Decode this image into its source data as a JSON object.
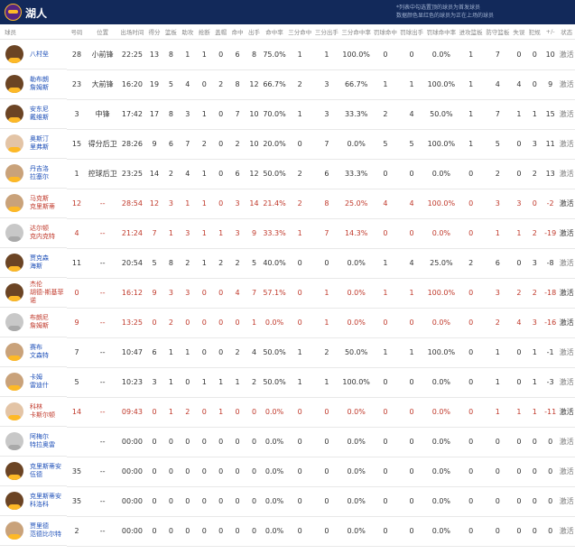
{
  "header": {
    "title": "湖人",
    "note_line1": "*列表中勾选置顶的球员为首发球员",
    "note_line2": "数据颜色显红色的球员为正在上场的球员"
  },
  "columns": [
    "球员",
    "号码",
    "位置",
    "出场时间",
    "得分",
    "篮板",
    "助攻",
    "抢断",
    "盖帽",
    "命中",
    "出手",
    "命中率",
    "三分命中",
    "三分出手",
    "三分命中率",
    "罚球命中",
    "罚球出手",
    "罚球命中率",
    "进攻篮板",
    "防守篮板",
    "失误",
    "犯规",
    "+/-",
    "状态"
  ],
  "players": [
    {
      "name": "八村垒",
      "avatar": "dark",
      "red": false,
      "cells": [
        "28",
        "小前锋",
        "22:25",
        "13",
        "8",
        "1",
        "1",
        "0",
        "6",
        "8",
        "75.0%",
        "1",
        "1",
        "100.0%",
        "0",
        "0",
        "0.0%",
        "1",
        "7",
        "0",
        "0",
        "10",
        "激活"
      ]
    },
    {
      "name": "勒布朗\n詹姆斯",
      "avatar": "dark",
      "red": false,
      "cells": [
        "23",
        "大前锋",
        "16:20",
        "19",
        "5",
        "4",
        "0",
        "2",
        "8",
        "12",
        "66.7%",
        "2",
        "3",
        "66.7%",
        "1",
        "1",
        "100.0%",
        "1",
        "4",
        "4",
        "0",
        "9",
        "激活"
      ]
    },
    {
      "name": "安东尼\n戴维斯",
      "avatar": "dark",
      "red": false,
      "cells": [
        "3",
        "中锋",
        "17:42",
        "17",
        "8",
        "3",
        "1",
        "0",
        "7",
        "10",
        "70.0%",
        "1",
        "3",
        "33.3%",
        "2",
        "4",
        "50.0%",
        "1",
        "7",
        "1",
        "1",
        "15",
        "激活"
      ]
    },
    {
      "name": "奥斯汀\n里弗斯",
      "avatar": "light",
      "red": false,
      "cells": [
        "15",
        "得分后卫",
        "28:26",
        "9",
        "6",
        "7",
        "2",
        "0",
        "2",
        "10",
        "20.0%",
        "0",
        "7",
        "0.0%",
        "5",
        "5",
        "100.0%",
        "1",
        "5",
        "0",
        "3",
        "11",
        "激活"
      ]
    },
    {
      "name": "丹吉洛\n拉塞尔",
      "avatar": "",
      "red": false,
      "cells": [
        "1",
        "控球后卫",
        "23:25",
        "14",
        "2",
        "4",
        "1",
        "0",
        "6",
        "12",
        "50.0%",
        "2",
        "6",
        "33.3%",
        "0",
        "0",
        "0.0%",
        "0",
        "2",
        "0",
        "2",
        "13",
        "激活"
      ]
    },
    {
      "name": "马克斯\n克里斯蒂",
      "avatar": "",
      "red": true,
      "cells": [
        "12",
        "--",
        "28:54",
        "12",
        "3",
        "1",
        "1",
        "0",
        "3",
        "14",
        "21.4%",
        "2",
        "8",
        "25.0%",
        "4",
        "4",
        "100.0%",
        "0",
        "3",
        "3",
        "0",
        "-2",
        "激活"
      ]
    },
    {
      "name": "达尔顿\n克内克特",
      "avatar": "gray",
      "red": true,
      "cells": [
        "4",
        "--",
        "21:24",
        "7",
        "1",
        "3",
        "1",
        "1",
        "3",
        "9",
        "33.3%",
        "1",
        "7",
        "14.3%",
        "0",
        "0",
        "0.0%",
        "0",
        "1",
        "1",
        "2",
        "-19",
        "激活"
      ]
    },
    {
      "name": "贾克森\n海斯",
      "avatar": "dark",
      "red": false,
      "cells": [
        "11",
        "--",
        "20:54",
        "5",
        "8",
        "2",
        "1",
        "2",
        "2",
        "5",
        "40.0%",
        "0",
        "0",
        "0.0%",
        "1",
        "4",
        "25.0%",
        "2",
        "6",
        "0",
        "3",
        "-8",
        "激活"
      ]
    },
    {
      "name": "杰伦\n胡德-斯基菲\n诺",
      "avatar": "dark",
      "red": true,
      "cells": [
        "0",
        "--",
        "16:12",
        "9",
        "3",
        "3",
        "0",
        "0",
        "4",
        "7",
        "57.1%",
        "0",
        "1",
        "0.0%",
        "1",
        "1",
        "100.0%",
        "0",
        "3",
        "2",
        "2",
        "-18",
        "激活"
      ]
    },
    {
      "name": "布朗尼\n詹姆斯",
      "avatar": "gray",
      "red": true,
      "cells": [
        "9",
        "--",
        "13:25",
        "0",
        "2",
        "0",
        "0",
        "0",
        "0",
        "1",
        "0.0%",
        "0",
        "1",
        "0.0%",
        "0",
        "0",
        "0.0%",
        "0",
        "2",
        "4",
        "3",
        "-16",
        "激活"
      ]
    },
    {
      "name": "赛布\n文森特",
      "avatar": "",
      "red": false,
      "cells": [
        "7",
        "--",
        "10:47",
        "6",
        "1",
        "1",
        "0",
        "0",
        "2",
        "4",
        "50.0%",
        "1",
        "2",
        "50.0%",
        "1",
        "1",
        "100.0%",
        "0",
        "1",
        "0",
        "1",
        "-1",
        "激活"
      ]
    },
    {
      "name": "卡姆\n雷迪什",
      "avatar": "",
      "red": false,
      "cells": [
        "5",
        "--",
        "10:23",
        "3",
        "1",
        "0",
        "1",
        "1",
        "1",
        "2",
        "50.0%",
        "1",
        "1",
        "100.0%",
        "0",
        "0",
        "0.0%",
        "0",
        "1",
        "0",
        "1",
        "-3",
        "激活"
      ]
    },
    {
      "name": "科林\n卡斯尔顿",
      "avatar": "light",
      "red": true,
      "cells": [
        "14",
        "--",
        "09:43",
        "0",
        "1",
        "2",
        "0",
        "1",
        "0",
        "0",
        "0.0%",
        "0",
        "0",
        "0.0%",
        "0",
        "0",
        "0.0%",
        "0",
        "1",
        "1",
        "1",
        "-11",
        "激活"
      ]
    },
    {
      "name": "阿梅尔\n特拉奥雷",
      "avatar": "gray",
      "red": false,
      "cells": [
        "",
        "--",
        "00:00",
        "0",
        "0",
        "0",
        "0",
        "0",
        "0",
        "0",
        "0.0%",
        "0",
        "0",
        "0.0%",
        "0",
        "0",
        "0.0%",
        "0",
        "0",
        "0",
        "0",
        "0",
        "激活"
      ]
    },
    {
      "name": "克里斯蒂安\n伍德",
      "avatar": "dark",
      "red": false,
      "cells": [
        "35",
        "--",
        "00:00",
        "0",
        "0",
        "0",
        "0",
        "0",
        "0",
        "0",
        "0.0%",
        "0",
        "0",
        "0.0%",
        "0",
        "0",
        "0.0%",
        "0",
        "0",
        "0",
        "0",
        "0",
        "激活"
      ]
    },
    {
      "name": "克里斯蒂安\n科洛科",
      "avatar": "dark",
      "red": false,
      "cells": [
        "35",
        "--",
        "00:00",
        "0",
        "0",
        "0",
        "0",
        "0",
        "0",
        "0",
        "0.0%",
        "0",
        "0",
        "0.0%",
        "0",
        "0",
        "0.0%",
        "0",
        "0",
        "0",
        "0",
        "0",
        "激活"
      ]
    },
    {
      "name": "贾里德\n范德比尔特",
      "avatar": "",
      "red": false,
      "cells": [
        "2",
        "--",
        "00:00",
        "0",
        "0",
        "0",
        "0",
        "0",
        "0",
        "0",
        "0.0%",
        "0",
        "0",
        "0.0%",
        "0",
        "0",
        "0.0%",
        "0",
        "0",
        "0",
        "0",
        "0",
        "激活"
      ]
    }
  ]
}
